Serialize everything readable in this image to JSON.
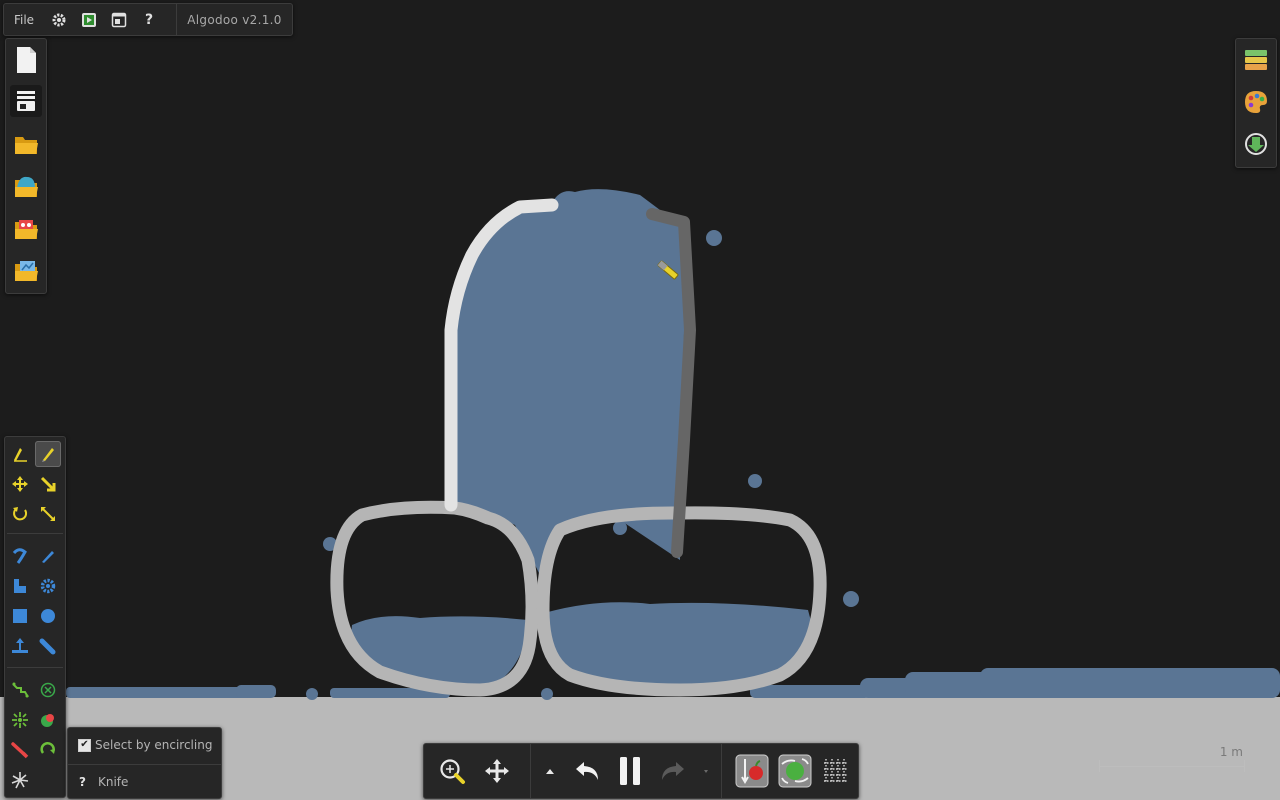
{
  "app": {
    "name": "Algodoo",
    "version_label": "Algodoo v2.1.0"
  },
  "topbar": {
    "file_label": "File",
    "icons": [
      "gear-icon",
      "play-scene-icon",
      "window-icon",
      "help-icon"
    ],
    "help_label": "?"
  },
  "left_toolbar": {
    "items": [
      {
        "name": "new-scene-icon"
      },
      {
        "name": "scene-options-icon",
        "active": true
      },
      {
        "name": "open-folder-icon"
      },
      {
        "name": "open-scene-icon"
      },
      {
        "name": "load-phunlet-icon"
      },
      {
        "name": "save-icon"
      }
    ]
  },
  "right_toolbar": {
    "items": [
      {
        "name": "layers-icon"
      },
      {
        "name": "palette-icon"
      },
      {
        "name": "download-icon"
      }
    ]
  },
  "tools": {
    "active": "knife",
    "groups": [
      [
        "sketch-tool",
        "knife-tool",
        "move-tool",
        "drag-tool",
        "rotate-tool",
        "scale-tool"
      ],
      [
        "rope-tool",
        "brush-tool",
        "polygon-tool",
        "gear-tool",
        "box-tool",
        "circle-tool",
        "plane-tool",
        "spring-tool"
      ],
      [
        "chain-tool",
        "fixate-tool",
        "thruster-tool",
        "laser-tool",
        "tracer-tool",
        "motor-tool",
        "water-tool"
      ]
    ]
  },
  "tool_options": {
    "select_by_encircling_label": "Select by encircling",
    "select_by_encircling_checked": true,
    "help_label": "?",
    "tool_name": "Knife"
  },
  "bottom_toolbar": {
    "items": [
      "zoom-icon",
      "pan-icon",
      "speed-down-icon",
      "undo-icon",
      "pause-icon",
      "redo-icon",
      "speed-up-icon",
      "gravity-icon",
      "air-friction-icon",
      "grid-icon"
    ],
    "simulation_state": "running"
  },
  "scale_bar": {
    "label": "1 m"
  },
  "colors": {
    "background": "#1c1c1c",
    "ground": "#b9b9b9",
    "water": "#5a7594",
    "outline_light": "#b5b5b5",
    "outline_white": "#e3e3e3",
    "stick": "#666666",
    "panel": "#262626",
    "accent_yellow": "#e8d22a",
    "tool_blue": "#3d88d8"
  }
}
